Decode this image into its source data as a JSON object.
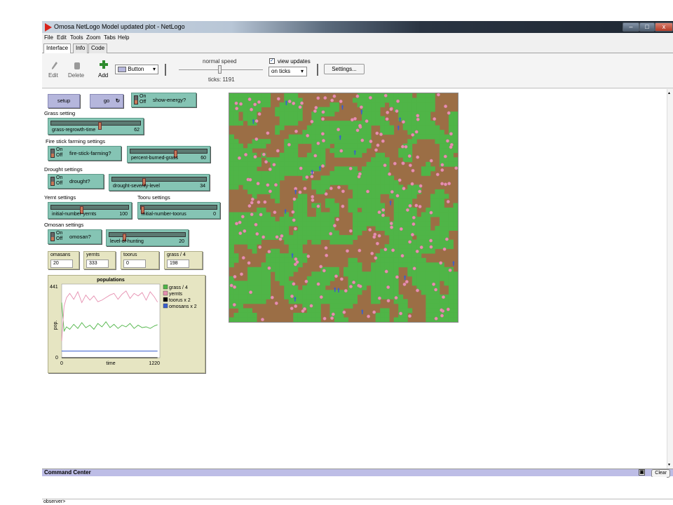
{
  "window": {
    "title": "Omosa NetLogo Model updated plot - NetLogo",
    "minimize": "–",
    "maximize": "□",
    "close": "x"
  },
  "menu": [
    "File",
    "Edit",
    "Tools",
    "Zoom",
    "Tabs",
    "Help"
  ],
  "tabs": [
    "Interface",
    "Info",
    "Code"
  ],
  "toolbar": {
    "edit": "Edit",
    "delete": "Delete",
    "add": "Add",
    "widget_type": "Button",
    "speed_label": "normal speed",
    "ticks_label": "ticks: 1191",
    "view_updates_label": "view updates",
    "view_updates_checked": true,
    "update_mode": "on ticks",
    "settings": "Settings..."
  },
  "interface": {
    "setup_button": "setup",
    "go_button": "go",
    "go_icon": "forever-loop-icon",
    "show_energy": "show-energy?",
    "on": "On",
    "off": "Off",
    "grass_setting": "Grass setting",
    "grass_regrowth_time": {
      "name": "grass-regrowth-time",
      "value": "62",
      "fraction": 0.55
    },
    "fire_stick_settings": "Fire stick farming settings",
    "fire_stick_farming": "fire-stick-farming?",
    "percent_burned_grass": {
      "name": "percent-burned-grass",
      "value": "60",
      "fraction": 0.6
    },
    "drought_settings": "Drought settings",
    "drought": "drought?",
    "drought_severity_level": {
      "name": "drought-severity-level",
      "value": "34",
      "fraction": 0.34
    },
    "yernt_settings": "Yernt settings",
    "tooru_settings": "Tooru settings",
    "initial_number_yernts": {
      "name": "initial-number-yernts",
      "value": "100",
      "fraction": 0.4
    },
    "initial_number_toorus": {
      "name": "initial-number-toorus",
      "value": "0",
      "fraction": 0.0
    },
    "omosan_settings": "Omosan settings",
    "omosan": "omosan?",
    "level_of_hunting": {
      "name": "level-of-hunting",
      "value": "20",
      "fraction": 0.2
    }
  },
  "monitors": [
    {
      "name": "omasans",
      "value": "20"
    },
    {
      "name": "yernts",
      "value": "333"
    },
    {
      "name": "toorus",
      "value": "0"
    },
    {
      "name": "grass / 4",
      "value": "198"
    }
  ],
  "colors": {
    "grass": "#4fb547",
    "dirt": "#9b6e45",
    "yernt": "#e68fb0",
    "omosan": "#3a5fcd",
    "button": "#b5b6dc",
    "switch": "#85c4b4",
    "monitor": "#e6e5c2"
  },
  "chart_data": {
    "type": "line",
    "title": "populations",
    "xlabel": "time",
    "ylabel": "pop.",
    "xlim": [
      0,
      1220
    ],
    "ylim": [
      0,
      441
    ],
    "x_ticks": [
      "0",
      "1220"
    ],
    "y_ticks": [
      "0",
      "441"
    ],
    "legend_position": "right",
    "series": [
      {
        "name": "grass / 4",
        "color": "#4fb547",
        "x": [
          0,
          30,
          60,
          100,
          150,
          200,
          250,
          300,
          350,
          400,
          450,
          500,
          550,
          600,
          650,
          700,
          750,
          800,
          850,
          900,
          950,
          1000,
          1050,
          1100,
          1150,
          1191
        ],
        "y": [
          330,
          160,
          185,
          170,
          200,
          175,
          210,
          180,
          195,
          170,
          205,
          185,
          215,
          180,
          200,
          175,
          195,
          185,
          205,
          175,
          195,
          180,
          185,
          175,
          190,
          198
        ]
      },
      {
        "name": "yernts",
        "color": "#e68fb0",
        "x": [
          0,
          30,
          60,
          100,
          150,
          200,
          250,
          300,
          350,
          400,
          450,
          500,
          550,
          600,
          650,
          700,
          750,
          800,
          850,
          900,
          950,
          1000,
          1050,
          1100,
          1150,
          1191
        ],
        "y": [
          100,
          310,
          360,
          385,
          350,
          395,
          330,
          375,
          345,
          370,
          335,
          345,
          360,
          375,
          385,
          350,
          380,
          400,
          355,
          385,
          370,
          390,
          345,
          395,
          365,
          333
        ]
      },
      {
        "name": "toorus x 2",
        "color": "#000000",
        "x": [
          0,
          1191
        ],
        "y": [
          0,
          0
        ]
      },
      {
        "name": "omosans x 2",
        "color": "#3a5fcd",
        "x": [
          0,
          1191
        ],
        "y": [
          40,
          40
        ]
      }
    ]
  },
  "command_center": {
    "title": "Command Center",
    "clear": "Clear",
    "prompt": "observer>"
  }
}
